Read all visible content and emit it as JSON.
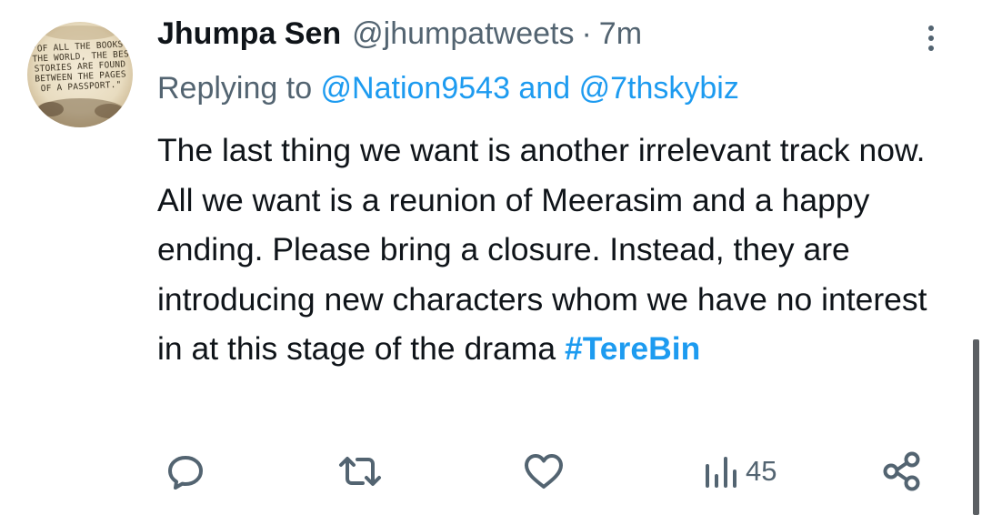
{
  "tweet": {
    "avatar": {
      "quote_lines": [
        "\"Of all the books in",
        "the world, the best",
        "stories are found",
        "between the pages",
        "of a passport.\""
      ]
    },
    "display_name": "Jhumpa Sen",
    "handle": "@jhumpatweets",
    "separator": "·",
    "time": "7m",
    "replying": {
      "prefix": "Replying to ",
      "mention1": "@Nation9543",
      "conjunction": " and ",
      "mention2": "@7thskybiz"
    },
    "body": "The last thing we want is another irrelevant track now. All we want is a reunion of Meerasim and a happy ending. Please bring a closure. Instead, they are introducing new characters whom we have no interest in at this stage of the drama",
    "hashtag": "#TereBin",
    "views": "45"
  },
  "icons": {
    "more": "more-vertical-icon",
    "reply": "reply-bubble-icon",
    "retweet": "retweet-icon",
    "like": "heart-icon",
    "views": "bar-chart-icon",
    "share": "share-nodes-icon"
  },
  "colors": {
    "link": "#1d9bf0",
    "muted": "#536471",
    "text": "#0f1419"
  }
}
